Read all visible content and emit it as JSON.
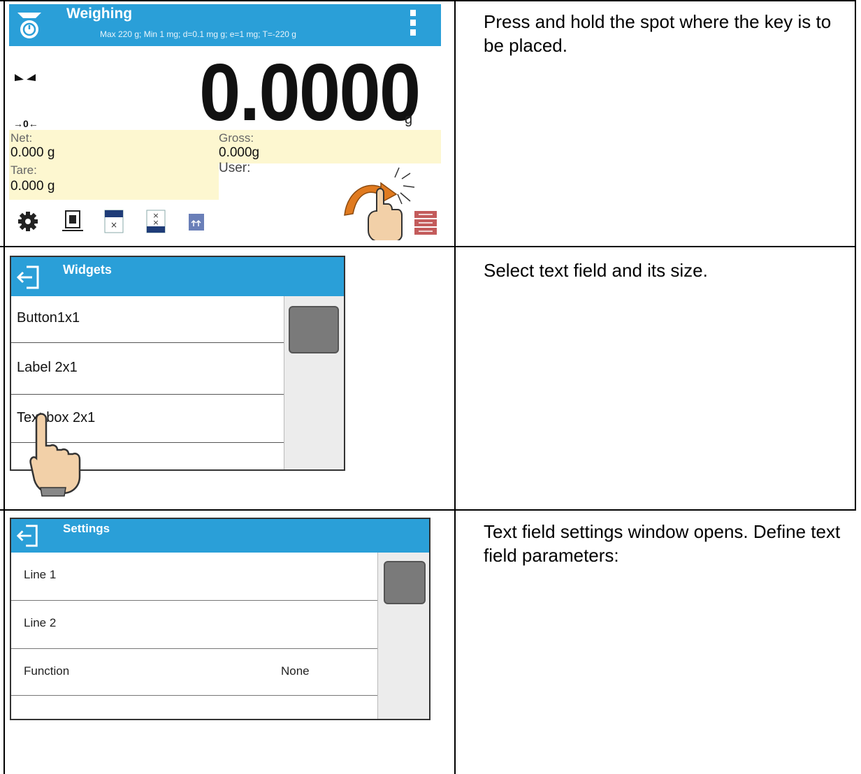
{
  "steps": [
    {
      "description": "Press and hold the spot where the key is to be placed."
    },
    {
      "description": "Select text field and its size."
    },
    {
      "description": "Text field settings window opens. Define text field parameters:"
    }
  ],
  "weighing": {
    "title": "Weighing",
    "subtitle": "Max 220 g; Min 1 mg; d=0.1 mg g; e=1 mg; T=-220 g",
    "value": "0.0000",
    "unit": "g",
    "zero_indicator": "→0←",
    "net_label": "Net:",
    "net_value": "0.000 g",
    "gross_label": "Gross:",
    "gross_value": "0.000g",
    "tare_label": "Tare:",
    "tare_value": "0.000 g",
    "user_label": "User:",
    "header_color": "#2a9fd8",
    "info_bg": "#fdf7d0"
  },
  "widgets": {
    "title": "Widgets",
    "items": [
      "Button1x1",
      "Label 2x1",
      "Text box 2x1",
      ""
    ]
  },
  "settings": {
    "title": "Settings",
    "items": [
      {
        "label": "Line 1",
        "value": ""
      },
      {
        "label": "Line 2",
        "value": ""
      },
      {
        "label": "Function",
        "value": "None"
      },
      {
        "label": "",
        "value": ""
      }
    ]
  }
}
